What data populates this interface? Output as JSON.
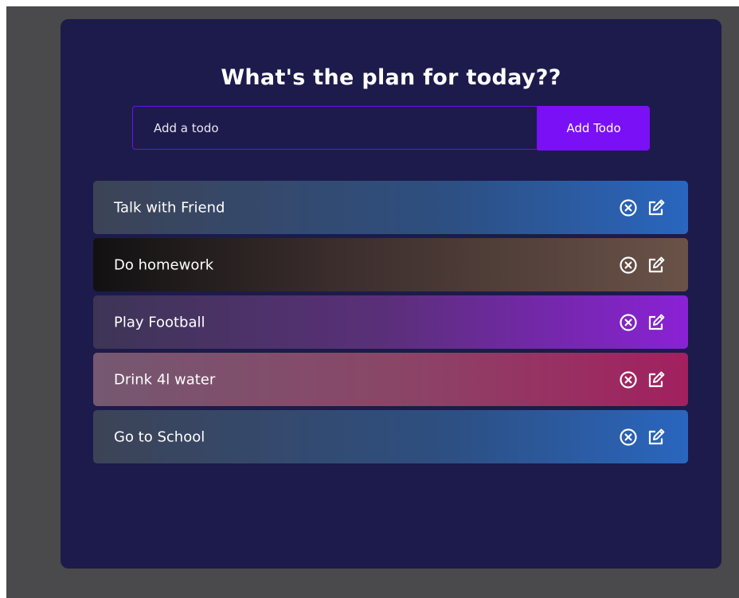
{
  "app": {
    "title": "What's the plan for today??"
  },
  "form": {
    "placeholder": "Add a todo",
    "value": "",
    "button_label": "Add Todo"
  },
  "todos": [
    {
      "text": "Talk with Friend",
      "gradient": [
        "#3c4356",
        "#2a66bf"
      ]
    },
    {
      "text": "Do homework",
      "gradient": [
        "#121112",
        "#6a5248"
      ]
    },
    {
      "text": "Play Football",
      "gradient": [
        "#3d3556",
        "#8a21d6"
      ]
    },
    {
      "text": "Drink 4l water",
      "gradient": [
        "#755871",
        "#a2205f"
      ]
    },
    {
      "text": "Go to School",
      "gradient": [
        "#3c4356",
        "#2a66bf"
      ]
    }
  ],
  "icons": {
    "delete": "close-circle-icon",
    "edit": "edit-icon"
  },
  "colors": {
    "app_background": "#1c1b4b",
    "page_background": "#4a494b",
    "accent": "#7a10f6",
    "input_border": "#6a13e8",
    "text": "#ffffff"
  }
}
